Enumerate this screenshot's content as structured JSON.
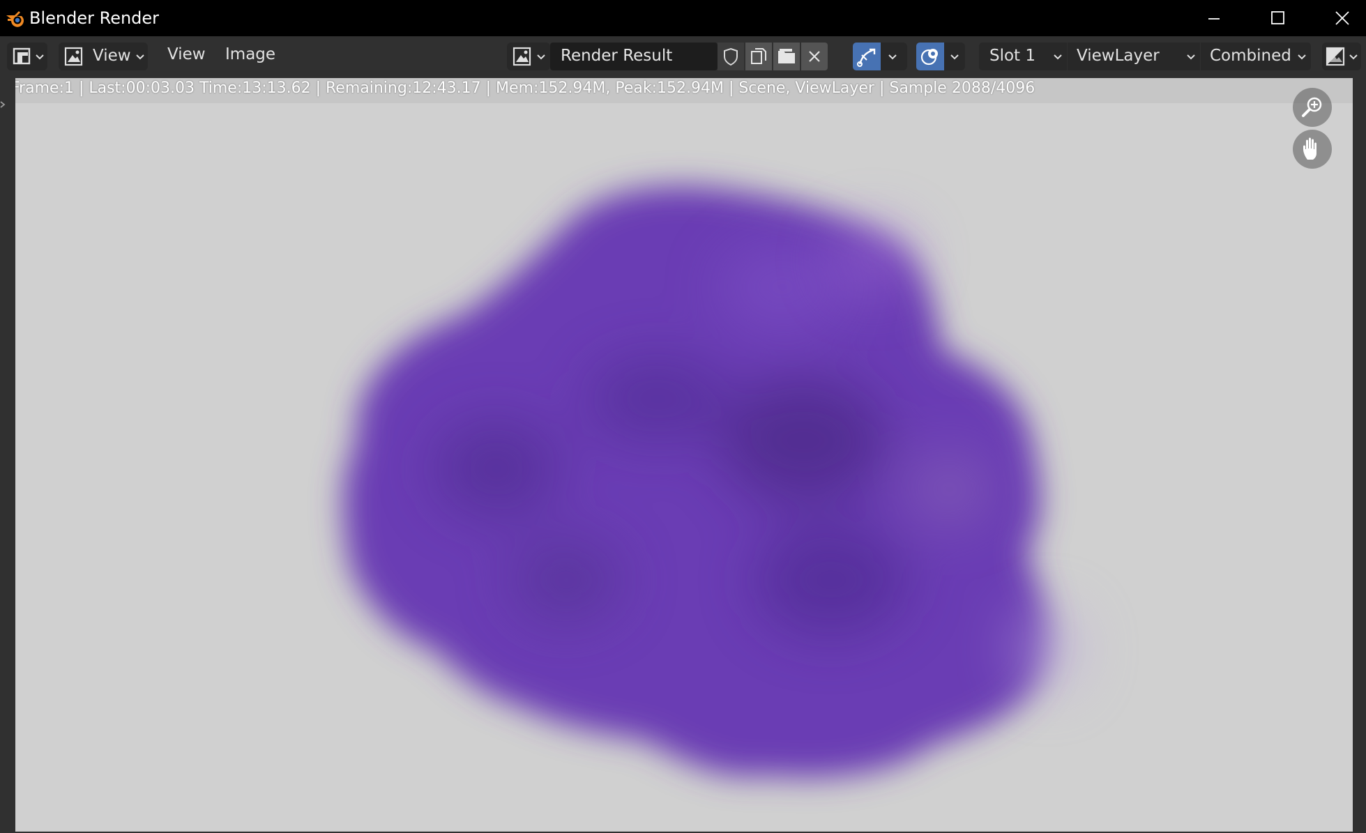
{
  "window": {
    "title": "Blender Render",
    "icons": {
      "app": "blender-logo-icon",
      "minimize": "minimize-icon",
      "maximize": "maximize-icon",
      "close": "close-icon"
    }
  },
  "header": {
    "editor_type_icon": "image-editor-icon",
    "mode_icon": "image-mode-icon",
    "mode_label": "View",
    "menus": [
      "View",
      "Image"
    ],
    "image_browse_icon": "image-browse-icon",
    "image_name": "Render Result",
    "image_buttons": [
      "fake-user-shield-icon",
      "new-image-icon",
      "open-folder-icon",
      "unlink-x-icon"
    ],
    "gizmo_toggle_icon": "gizmo-icon",
    "overlay_toggle_icon": "overlay-icon",
    "slot": "Slot 1",
    "view_layer": "ViewLayer",
    "pass": "Combined",
    "display_channels_icon": "display-channels-icon"
  },
  "render": {
    "stats": "Frame:1 | Last:00:03.03 Time:13:13.62 | Remaining:12:43.17 | Mem:152.94M, Peak:152.94M | Scene, ViewLayer | Sample 2088/4096",
    "background_color": "#d0d0d0",
    "smoke_color": "#6a3cb4"
  },
  "nav_gizmos": [
    "zoom-icon",
    "pan-hand-icon"
  ],
  "colors": {
    "accent": "#4772b3",
    "titlebar": "#000000",
    "header": "#303030"
  }
}
